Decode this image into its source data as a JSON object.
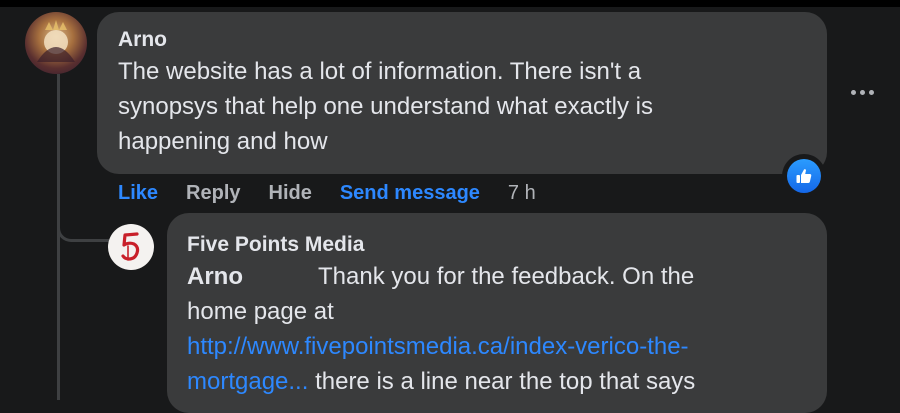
{
  "comment": {
    "author": "Arno",
    "lines": [
      "The website has a lot of information. There isn't a",
      "synopsys that help one understand what exactly is",
      "happening and how"
    ],
    "actions": {
      "like": "Like",
      "reply": "Reply",
      "hide": "Hide",
      "send_message": "Send message",
      "time": "7 h"
    },
    "reaction_icon": "thumbs-up-icon",
    "more_icon": "more-horizontal-icon"
  },
  "reply": {
    "author": "Five Points Media",
    "tag": "Arno",
    "line1": "Thank you for the feedback. On the",
    "line2": "home page at",
    "link_line1": "http://www.fivepointsmedia.ca/index-verico-the-",
    "link_line2": "mortgage...",
    "line3_rest": " there is a line near the top that says"
  },
  "colors": {
    "background": "#18191a",
    "bubble": "#3a3b3c",
    "link": "#2d88ff",
    "muted": "#b0b3b8"
  }
}
